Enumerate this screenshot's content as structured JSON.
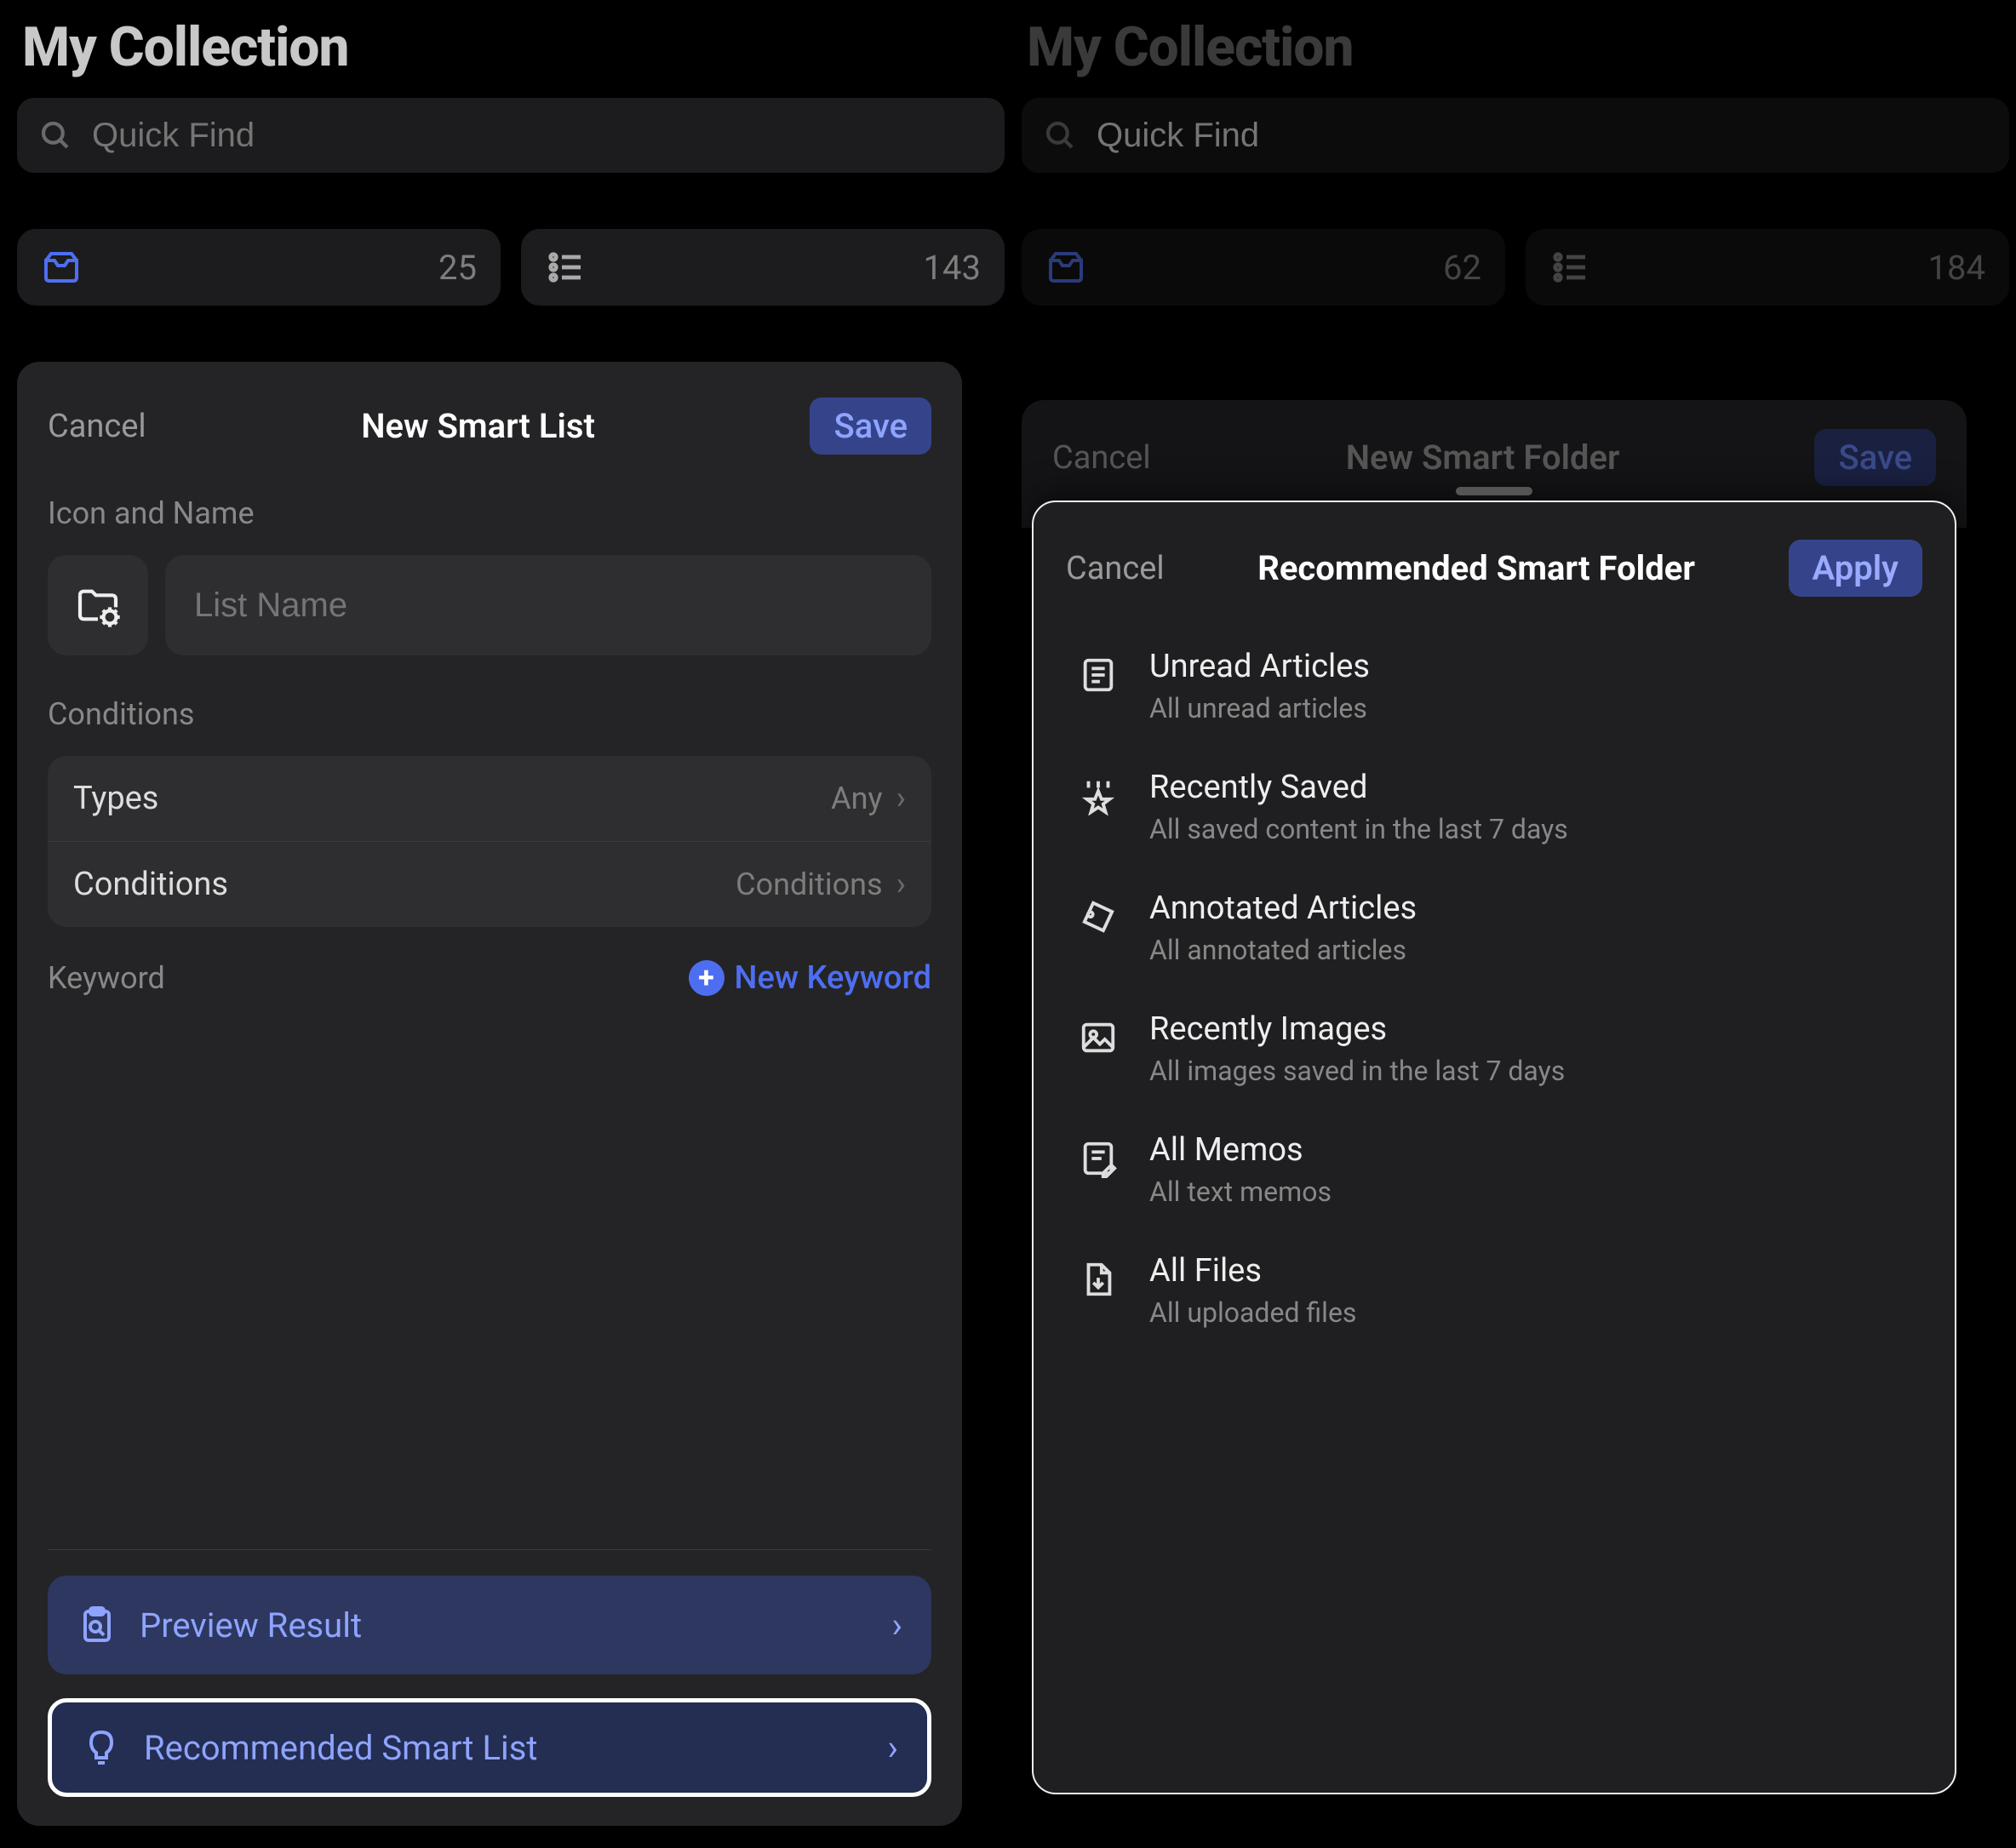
{
  "left": {
    "title": "My Collection",
    "search_placeholder": "Quick Find",
    "card1": 25,
    "card2": 143,
    "sheet": {
      "cancel": "Cancel",
      "title": "New Smart List",
      "save": "Save",
      "icon_name_label": "Icon and Name",
      "name_placeholder": "List Name",
      "conditions_label": "Conditions",
      "types_label": "Types",
      "types_value": "Any",
      "conditions_row_label": "Conditions",
      "conditions_row_value": "Conditions",
      "keyword_label": "Keyword",
      "new_keyword": "New Keyword",
      "preview_result": "Preview Result",
      "recommended": "Recommended Smart List"
    }
  },
  "right": {
    "title": "My Collection",
    "search_placeholder": "Quick Find",
    "card1": 62,
    "card2": 184,
    "sheet1": {
      "cancel": "Cancel",
      "title": "New Smart Folder",
      "save": "Save"
    },
    "sheet2": {
      "cancel": "Cancel",
      "title": "Recommended Smart Folder",
      "apply": "Apply",
      "items": [
        {
          "t": "Unread Articles",
          "s": "All unread articles"
        },
        {
          "t": "Recently Saved",
          "s": "All saved content in the last 7 days"
        },
        {
          "t": "Annotated Articles",
          "s": "All annotated articles"
        },
        {
          "t": "Recently Images",
          "s": "All images saved in the last 7 days"
        },
        {
          "t": "All Memos",
          "s": "All text memos"
        },
        {
          "t": "All Files",
          "s": "All uploaded files"
        }
      ]
    }
  }
}
